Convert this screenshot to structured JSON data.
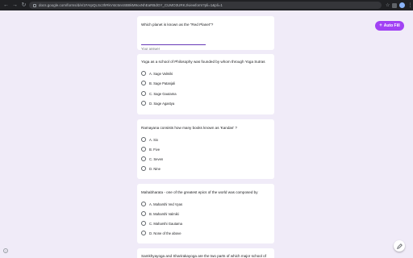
{
  "browser": {
    "url": "docs.google.com/forms/d/e/1FAIpQLSc3hRkVstc5nnSB8kM9oxNhEaRBdGY_CUMO3URKJ/viewform?pli=1&pli=1"
  },
  "questions": [
    {
      "text": "Which planet is known as the \"Red Planet\"?",
      "answer_placeholder": "Your answer"
    },
    {
      "text": "Yoga as a school of Philosophy was founded by whom through Yoga Sutras",
      "options": [
        "A. Sage Valmiki",
        "B. Sage Patanjali",
        "C. Sage Gautama",
        "D. Sage Agastya"
      ]
    },
    {
      "text": "Ramayana consists how many books known as 'Kandas' ?",
      "options": [
        "A. Six",
        "B. Five",
        "C. Seven",
        "D. Nine"
      ]
    },
    {
      "text": "Mahabharata - one of the greatest epics of the world was composed by",
      "options": [
        "A. Maharshi Ved Vyas",
        "B. Maharshi Valmiki",
        "C. Maharshi Gautama",
        "D. None of the above"
      ]
    },
    {
      "text": "Samkhyayoga and Sharirakayoga are the two parts of which major school of"
    }
  ],
  "autofill": {
    "label": "Auto Fill"
  },
  "icons": {
    "back": "back-arrow-icon",
    "forward": "forward-arrow-icon",
    "reload": "reload-icon",
    "edit": "pencil-icon",
    "help": "help-icon"
  }
}
